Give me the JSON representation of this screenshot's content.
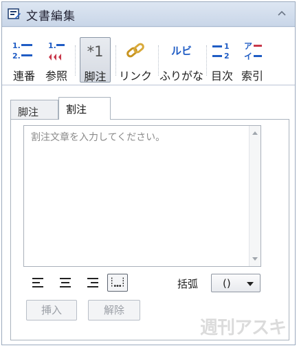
{
  "panel": {
    "title": "文書編集"
  },
  "toolbar": {
    "items": [
      {
        "label": "連番",
        "icon": "numbered-list-icon"
      },
      {
        "label": "参照",
        "icon": "reference-icon"
      },
      {
        "label": "脚注",
        "icon": "footnote-icon",
        "icon_text": "*1",
        "active": true
      },
      {
        "label": "リンク",
        "icon": "link-icon"
      },
      {
        "label": "ふりがな",
        "icon": "ruby-icon",
        "icon_text": "ルビ"
      },
      {
        "label": "目次",
        "icon": "toc-icon",
        "icon_text": "1 2"
      },
      {
        "label": "索引",
        "icon": "index-icon",
        "icon_text": "アイ"
      }
    ]
  },
  "tabs": [
    {
      "label": "脚注",
      "active": false
    },
    {
      "label": "割注",
      "active": true
    }
  ],
  "editor": {
    "placeholder": "割注文章を入力してください。"
  },
  "alignment": {
    "buttons": [
      "align-left-icon",
      "align-center-icon",
      "align-right-icon",
      "align-justify-icon"
    ],
    "selected": "align-justify-icon"
  },
  "bracket": {
    "label": "括弧",
    "value": "()"
  },
  "actions": {
    "insert": "挿入",
    "delete": "解除"
  },
  "watermark": "週刊アスキー",
  "colors": {
    "accent": "#1f5cc4",
    "active_tool_bg": "#d5dae2",
    "link_gold": "#c8941f"
  }
}
